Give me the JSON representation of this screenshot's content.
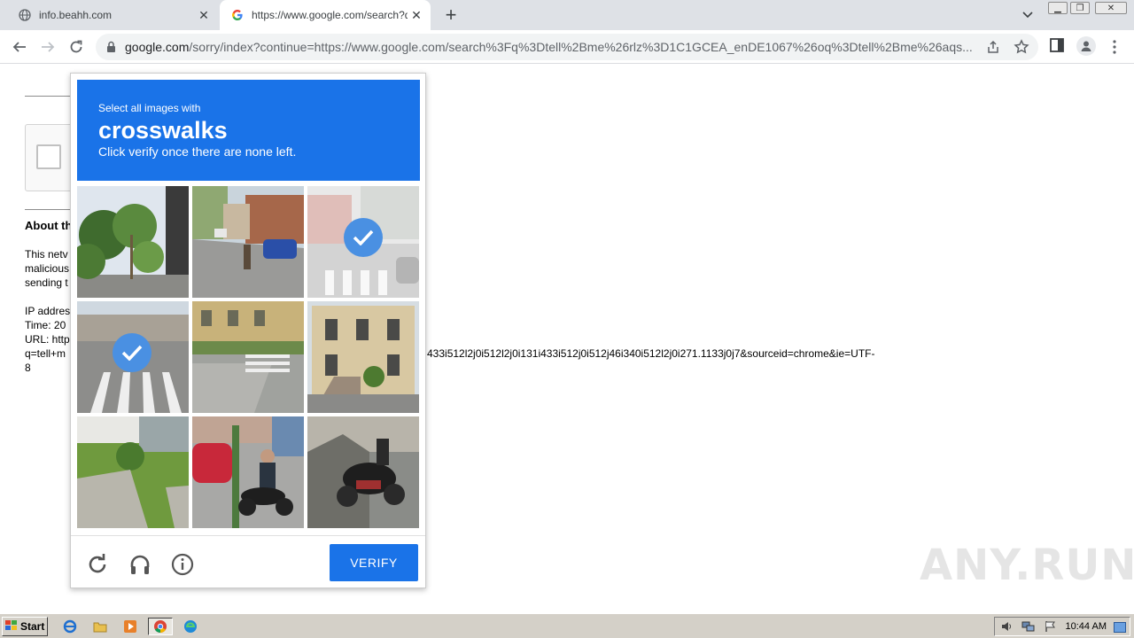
{
  "tabs": [
    {
      "title": "info.beahh.com",
      "active": false
    },
    {
      "title": "https://www.google.com/search?q=",
      "active": true
    }
  ],
  "toolbar": {
    "url_host": "google.com",
    "url_rest": "/sorry/index?continue=https://www.google.com/search%3Fq%3Dtell%2Bme%26rlz%3D1C1GCEA_enDE1067%26oq%3Dtell%2Bme%26aqs..."
  },
  "page": {
    "about_heading": "About th",
    "para_lines": [
      "This netv",
      "malicious",
      "sending t"
    ],
    "info_lines": [
      "IP addres",
      "Time: 20",
      "URL: http",
      "q=tell+m",
      "8"
    ],
    "long_line": "433i512l2j0i512l2j0i131i433i512j0i512j46i340i512l2j0i271.1133j0j7&sourceid=chrome&ie=UTF-"
  },
  "captcha": {
    "instruction_small": "Select all images with",
    "target": "crosswalks",
    "instruction_sub": "Click verify once there are none left.",
    "verify_label": "VERIFY",
    "tiles": [
      {
        "subject": "palm-trees-road",
        "selected": false
      },
      {
        "subject": "street-cyclist-cars",
        "selected": false
      },
      {
        "subject": "crosswalk-faded",
        "selected": true
      },
      {
        "subject": "crosswalk-street",
        "selected": true
      },
      {
        "subject": "crosswalk-corner",
        "selected": false
      },
      {
        "subject": "victorian-house",
        "selected": false
      },
      {
        "subject": "stairs-lawn",
        "selected": false
      },
      {
        "subject": "motorcycle-rider-car",
        "selected": false
      },
      {
        "subject": "parked-scooter",
        "selected": false
      }
    ]
  },
  "watermark": "ANY.RUN",
  "taskbar": {
    "start_label": "Start",
    "clock": "10:44 AM"
  },
  "colors": {
    "accent": "#1a73e8",
    "check": "#4a90e2"
  }
}
